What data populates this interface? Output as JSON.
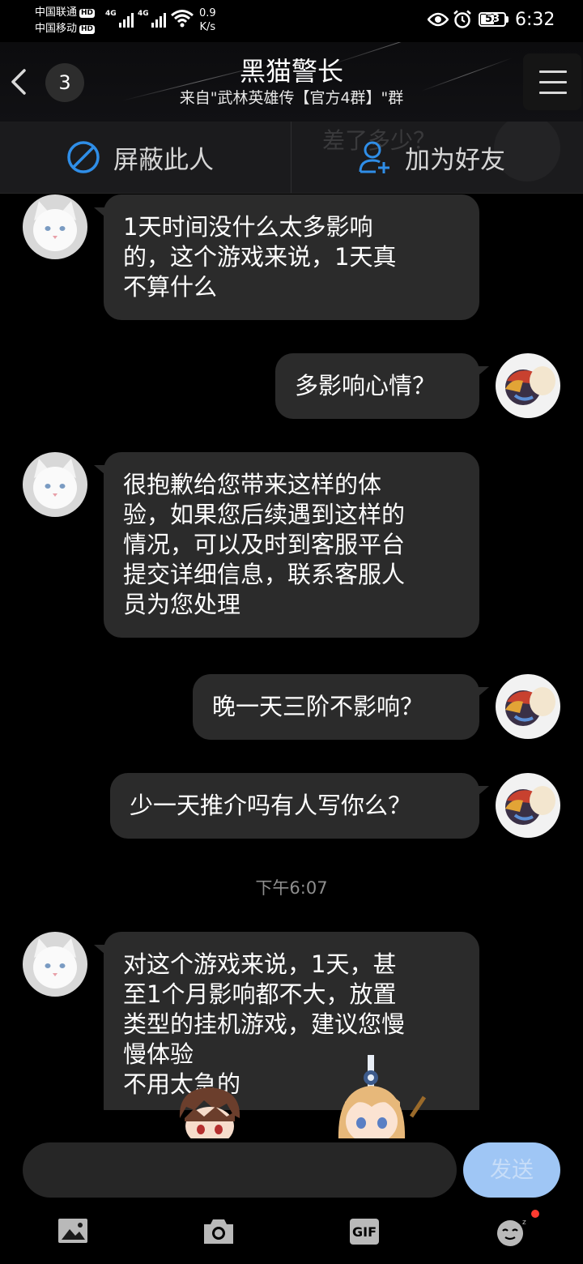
{
  "status_bar": {
    "carrier_1": "中国联通",
    "carrier_2": "中国移动",
    "hd_badge": "HD",
    "network_type": "4G",
    "speed_value": "0.9",
    "speed_unit": "K/s",
    "battery": "53",
    "time": "6:32"
  },
  "header": {
    "unread_count": "3",
    "title": "黑猫警长",
    "subtitle": "来自\"武林英雄传【官方4群】\"群"
  },
  "actions": {
    "block_label": "屏蔽此人",
    "add_friend_label": "加为好友",
    "background_text": "差了多少？"
  },
  "messages": [
    {
      "side": "left",
      "lines": [
        "1天时间没什么太多影响",
        "的，这个游戏来说，1天真",
        "不算什么"
      ]
    },
    {
      "side": "right",
      "lines": [
        "多影响心情？"
      ]
    },
    {
      "side": "left",
      "lines": [
        "很抱歉给您带来这样的体",
        "验，如果您后续遇到这样的",
        "情况，可以及时到客服平台",
        "提交详细信息，联系客服人",
        "员为您处理"
      ]
    },
    {
      "side": "right",
      "lines": [
        "晚一天三阶不影响？"
      ]
    },
    {
      "side": "right",
      "lines": [
        "少一天推介吗有人写你么？"
      ]
    },
    {
      "side": "left",
      "lines": [
        "对这个游戏来说，1天，甚",
        "至1个月影响都不大，放置",
        "类型的挂机游戏，建议您慢",
        "慢体验",
        "不用太急的"
      ]
    }
  ],
  "timestamp": "下午6:07",
  "input": {
    "value": "",
    "send_label": "发送"
  },
  "toolbar": {
    "gif_label": "GIF"
  },
  "colors": {
    "background": "#000000",
    "bubble": "#2b2b2b",
    "send_button": "#9fc6f5",
    "action_icon": "#2f8ee8",
    "notification_dot": "#ff3b30"
  }
}
